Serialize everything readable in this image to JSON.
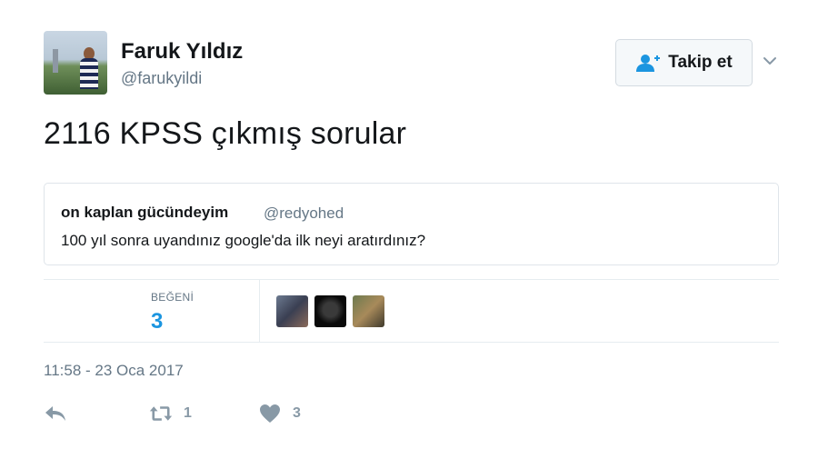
{
  "header": {
    "display_name": "Faruk Yıldız",
    "handle": "@farukyildi",
    "follow_label": "Takip et"
  },
  "tweet": {
    "text": "2116 KPSS çıkmış sorular"
  },
  "quote": {
    "display_name": "on kaplan gücündeyim",
    "handle": "@redyohed",
    "text": "100 yıl sonra uyandınız google'da ilk neyi aratırdınız?"
  },
  "stats": {
    "likes_label": "BEĞENİ",
    "likes_count": "3"
  },
  "timestamp": "11:58 - 23 Oca 2017",
  "actions": {
    "retweet_count": "1",
    "like_count": "3"
  },
  "colors": {
    "accent": "#1b95e0",
    "muted": "#657786",
    "icon": "#8899a6"
  }
}
